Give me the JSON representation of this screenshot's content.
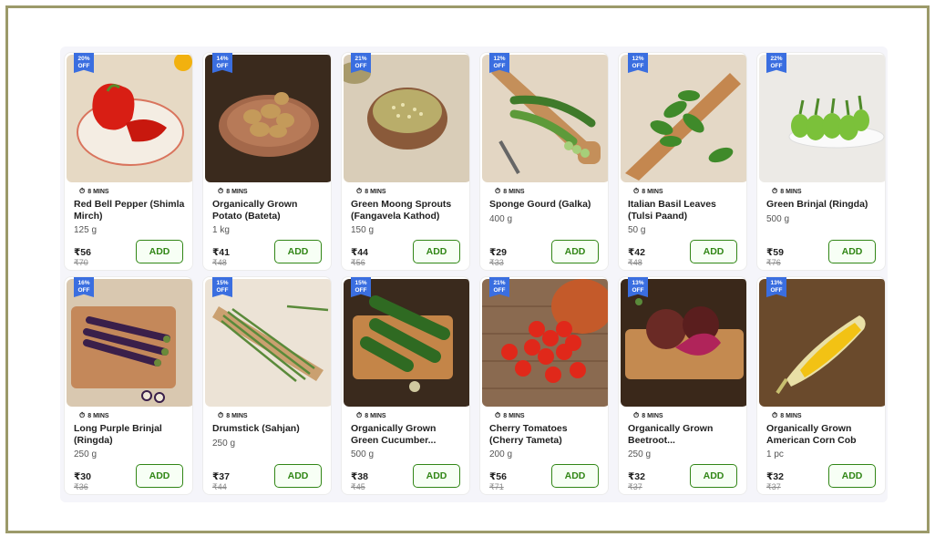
{
  "eta_label": "8 MINS",
  "add_label": "ADD",
  "products": [
    {
      "discount": "20%\nOFF",
      "name": "Red Bell Pepper (Shimla Mirch)",
      "qty": "125 g",
      "price": "₹56",
      "mrp": "₹70",
      "image": "red-bell-pepper"
    },
    {
      "discount": "14%\nOFF",
      "name": "Organically Grown Potato (Bateta)",
      "qty": "1 kg",
      "price": "₹41",
      "mrp": "₹48",
      "image": "potatoes"
    },
    {
      "discount": "21%\nOFF",
      "name": "Green Moong Sprouts (Fangavela Kathod)",
      "qty": "150 g",
      "price": "₹44",
      "mrp": "₹56",
      "image": "moong-sprouts"
    },
    {
      "discount": "12%\nOFF",
      "name": "Sponge Gourd (Galka)",
      "qty": "400 g",
      "price": "₹29",
      "mrp": "₹33",
      "image": "sponge-gourd"
    },
    {
      "discount": "12%\nOFF",
      "name": "Italian Basil Leaves (Tulsi Paand)",
      "qty": "50 g",
      "price": "₹42",
      "mrp": "₹48",
      "image": "basil-leaves"
    },
    {
      "discount": "22%\nOFF",
      "name": "Green Brinjal (Ringda)",
      "qty": "500 g",
      "price": "₹59",
      "mrp": "₹76",
      "image": "green-brinjal"
    },
    {
      "discount": "16%\nOFF",
      "name": "Long Purple Brinjal (Ringda)",
      "qty": "250 g",
      "price": "₹30",
      "mrp": "₹36",
      "image": "purple-brinjal"
    },
    {
      "discount": "15%\nOFF",
      "name": "Drumstick (Sahjan)",
      "qty": "250 g",
      "price": "₹37",
      "mrp": "₹44",
      "image": "drumstick"
    },
    {
      "discount": "15%\nOFF",
      "name": "Organically Grown Green Cucumber...",
      "qty": "500 g",
      "price": "₹38",
      "mrp": "₹45",
      "image": "cucumber"
    },
    {
      "discount": "21%\nOFF",
      "name": "Cherry Tomatoes (Cherry Tameta)",
      "qty": "200 g",
      "price": "₹56",
      "mrp": "₹71",
      "image": "cherry-tomatoes"
    },
    {
      "discount": "13%\nOFF",
      "name": "Organically Grown Beetroot...",
      "qty": "250 g",
      "price": "₹32",
      "mrp": "₹37",
      "image": "beetroot"
    },
    {
      "discount": "13%\nOFF",
      "name": "Organically Grown American Corn Cob",
      "qty": "1 pc",
      "price": "₹32",
      "mrp": "₹37",
      "image": "corn-cob"
    }
  ],
  "colors": {
    "accent_green": "#318616",
    "badge_blue": "#3a6ee0",
    "frame": "#9c9a6a"
  }
}
